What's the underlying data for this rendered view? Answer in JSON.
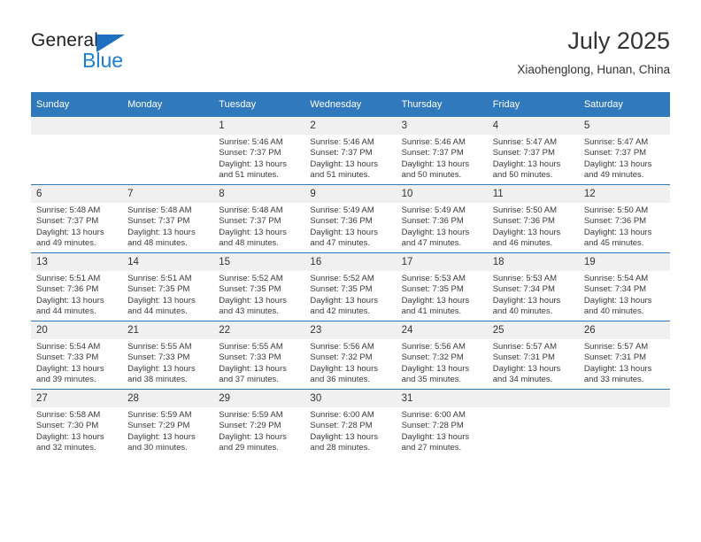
{
  "brand": {
    "name_part1": "General",
    "name_part2": "Blue"
  },
  "header": {
    "month_title": "July 2025",
    "location": "Xiaohenglong, Hunan, China"
  },
  "calendar": {
    "accent_color": "#3179bd",
    "daynum_band_color": "#f0f0f0",
    "weekday_headers": [
      "Sunday",
      "Monday",
      "Tuesday",
      "Wednesday",
      "Thursday",
      "Friday",
      "Saturday"
    ],
    "weeks": [
      [
        {
          "day": "",
          "blank": true
        },
        {
          "day": "",
          "blank": true
        },
        {
          "day": "1",
          "sunrise": "Sunrise: 5:46 AM",
          "sunset": "Sunset: 7:37 PM",
          "daylight": "Daylight: 13 hours and 51 minutes."
        },
        {
          "day": "2",
          "sunrise": "Sunrise: 5:46 AM",
          "sunset": "Sunset: 7:37 PM",
          "daylight": "Daylight: 13 hours and 51 minutes."
        },
        {
          "day": "3",
          "sunrise": "Sunrise: 5:46 AM",
          "sunset": "Sunset: 7:37 PM",
          "daylight": "Daylight: 13 hours and 50 minutes."
        },
        {
          "day": "4",
          "sunrise": "Sunrise: 5:47 AM",
          "sunset": "Sunset: 7:37 PM",
          "daylight": "Daylight: 13 hours and 50 minutes."
        },
        {
          "day": "5",
          "sunrise": "Sunrise: 5:47 AM",
          "sunset": "Sunset: 7:37 PM",
          "daylight": "Daylight: 13 hours and 49 minutes."
        }
      ],
      [
        {
          "day": "6",
          "sunrise": "Sunrise: 5:48 AM",
          "sunset": "Sunset: 7:37 PM",
          "daylight": "Daylight: 13 hours and 49 minutes."
        },
        {
          "day": "7",
          "sunrise": "Sunrise: 5:48 AM",
          "sunset": "Sunset: 7:37 PM",
          "daylight": "Daylight: 13 hours and 48 minutes."
        },
        {
          "day": "8",
          "sunrise": "Sunrise: 5:48 AM",
          "sunset": "Sunset: 7:37 PM",
          "daylight": "Daylight: 13 hours and 48 minutes."
        },
        {
          "day": "9",
          "sunrise": "Sunrise: 5:49 AM",
          "sunset": "Sunset: 7:36 PM",
          "daylight": "Daylight: 13 hours and 47 minutes."
        },
        {
          "day": "10",
          "sunrise": "Sunrise: 5:49 AM",
          "sunset": "Sunset: 7:36 PM",
          "daylight": "Daylight: 13 hours and 47 minutes."
        },
        {
          "day": "11",
          "sunrise": "Sunrise: 5:50 AM",
          "sunset": "Sunset: 7:36 PM",
          "daylight": "Daylight: 13 hours and 46 minutes."
        },
        {
          "day": "12",
          "sunrise": "Sunrise: 5:50 AM",
          "sunset": "Sunset: 7:36 PM",
          "daylight": "Daylight: 13 hours and 45 minutes."
        }
      ],
      [
        {
          "day": "13",
          "sunrise": "Sunrise: 5:51 AM",
          "sunset": "Sunset: 7:36 PM",
          "daylight": "Daylight: 13 hours and 44 minutes."
        },
        {
          "day": "14",
          "sunrise": "Sunrise: 5:51 AM",
          "sunset": "Sunset: 7:35 PM",
          "daylight": "Daylight: 13 hours and 44 minutes."
        },
        {
          "day": "15",
          "sunrise": "Sunrise: 5:52 AM",
          "sunset": "Sunset: 7:35 PM",
          "daylight": "Daylight: 13 hours and 43 minutes."
        },
        {
          "day": "16",
          "sunrise": "Sunrise: 5:52 AM",
          "sunset": "Sunset: 7:35 PM",
          "daylight": "Daylight: 13 hours and 42 minutes."
        },
        {
          "day": "17",
          "sunrise": "Sunrise: 5:53 AM",
          "sunset": "Sunset: 7:35 PM",
          "daylight": "Daylight: 13 hours and 41 minutes."
        },
        {
          "day": "18",
          "sunrise": "Sunrise: 5:53 AM",
          "sunset": "Sunset: 7:34 PM",
          "daylight": "Daylight: 13 hours and 40 minutes."
        },
        {
          "day": "19",
          "sunrise": "Sunrise: 5:54 AM",
          "sunset": "Sunset: 7:34 PM",
          "daylight": "Daylight: 13 hours and 40 minutes."
        }
      ],
      [
        {
          "day": "20",
          "sunrise": "Sunrise: 5:54 AM",
          "sunset": "Sunset: 7:33 PM",
          "daylight": "Daylight: 13 hours and 39 minutes."
        },
        {
          "day": "21",
          "sunrise": "Sunrise: 5:55 AM",
          "sunset": "Sunset: 7:33 PM",
          "daylight": "Daylight: 13 hours and 38 minutes."
        },
        {
          "day": "22",
          "sunrise": "Sunrise: 5:55 AM",
          "sunset": "Sunset: 7:33 PM",
          "daylight": "Daylight: 13 hours and 37 minutes."
        },
        {
          "day": "23",
          "sunrise": "Sunrise: 5:56 AM",
          "sunset": "Sunset: 7:32 PM",
          "daylight": "Daylight: 13 hours and 36 minutes."
        },
        {
          "day": "24",
          "sunrise": "Sunrise: 5:56 AM",
          "sunset": "Sunset: 7:32 PM",
          "daylight": "Daylight: 13 hours and 35 minutes."
        },
        {
          "day": "25",
          "sunrise": "Sunrise: 5:57 AM",
          "sunset": "Sunset: 7:31 PM",
          "daylight": "Daylight: 13 hours and 34 minutes."
        },
        {
          "day": "26",
          "sunrise": "Sunrise: 5:57 AM",
          "sunset": "Sunset: 7:31 PM",
          "daylight": "Daylight: 13 hours and 33 minutes."
        }
      ],
      [
        {
          "day": "27",
          "sunrise": "Sunrise: 5:58 AM",
          "sunset": "Sunset: 7:30 PM",
          "daylight": "Daylight: 13 hours and 32 minutes."
        },
        {
          "day": "28",
          "sunrise": "Sunrise: 5:59 AM",
          "sunset": "Sunset: 7:29 PM",
          "daylight": "Daylight: 13 hours and 30 minutes."
        },
        {
          "day": "29",
          "sunrise": "Sunrise: 5:59 AM",
          "sunset": "Sunset: 7:29 PM",
          "daylight": "Daylight: 13 hours and 29 minutes."
        },
        {
          "day": "30",
          "sunrise": "Sunrise: 6:00 AM",
          "sunset": "Sunset: 7:28 PM",
          "daylight": "Daylight: 13 hours and 28 minutes."
        },
        {
          "day": "31",
          "sunrise": "Sunrise: 6:00 AM",
          "sunset": "Sunset: 7:28 PM",
          "daylight": "Daylight: 13 hours and 27 minutes."
        },
        {
          "day": "",
          "blank": true
        },
        {
          "day": "",
          "blank": true
        }
      ]
    ]
  }
}
